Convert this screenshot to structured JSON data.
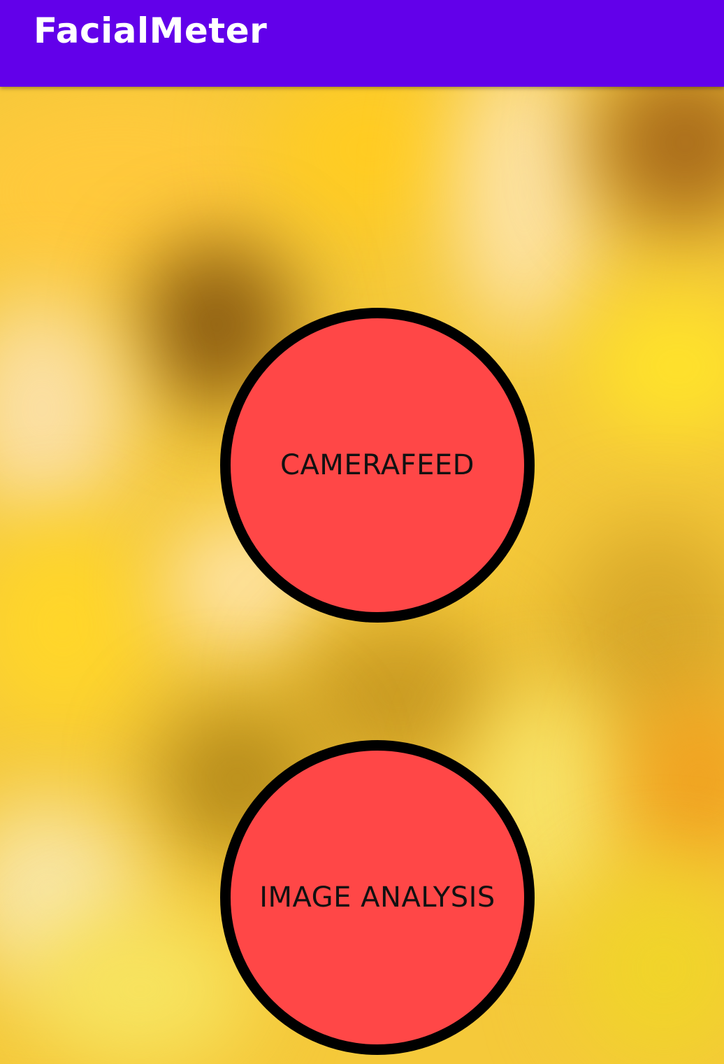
{
  "app": {
    "title": "FacialMeter"
  },
  "buttons": {
    "camera_feed": "CAMERAFEED",
    "image_analysis": "IMAGE ANALYSIS"
  },
  "colors": {
    "app_bar": "#6200EA",
    "button_fill": "#FF4747",
    "button_border": "#000000",
    "background_base": "#F5C93A"
  }
}
